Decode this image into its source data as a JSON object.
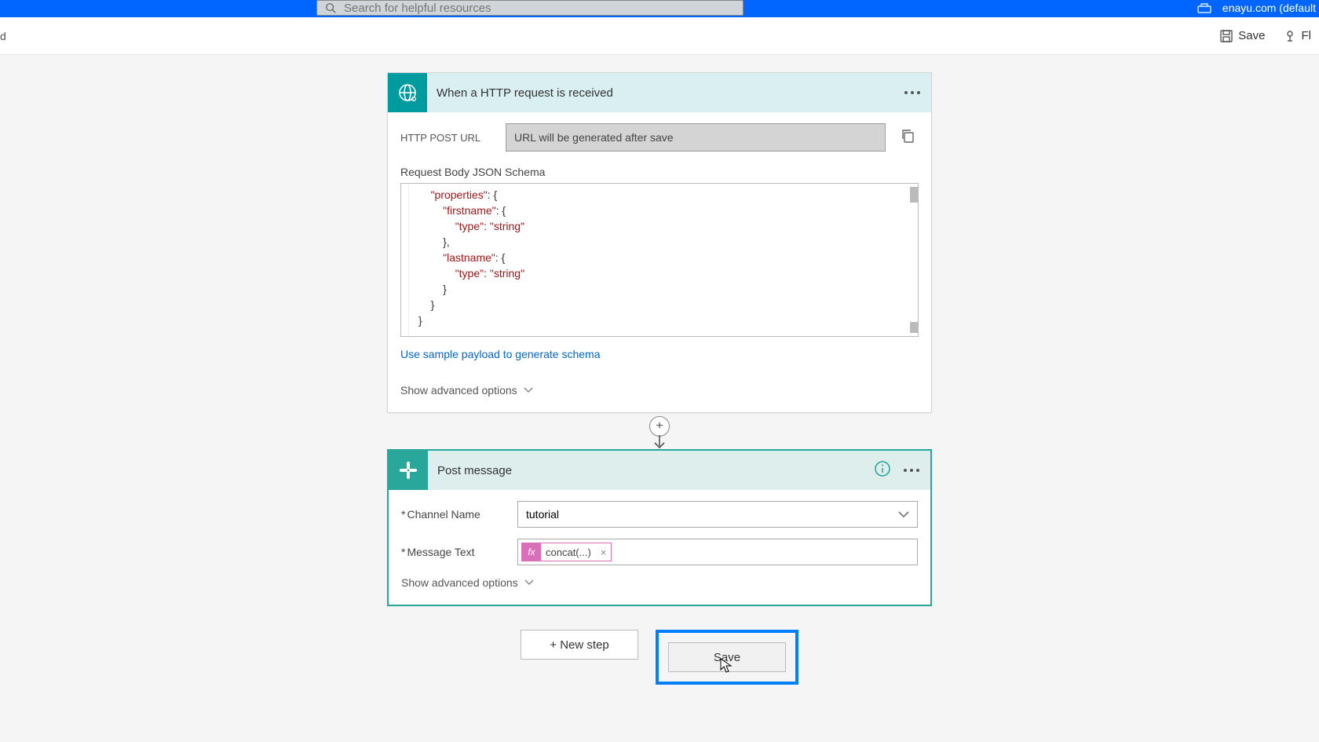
{
  "topbar": {
    "search_placeholder": "Search for helpful resources",
    "tenant": "enayu.com (default"
  },
  "cmdbar": {
    "crumb": "d",
    "save": "Save",
    "flow": "Fl"
  },
  "http": {
    "title": "When a HTTP request is received",
    "post_label": "HTTP POST URL",
    "post_value": "URL will be generated after save",
    "schema_label": "Request Body JSON Schema",
    "sample_link": "Use sample payload to generate schema",
    "advanced": "Show advanced options",
    "code": {
      "l1a": "\"properties\"",
      "l1b": ": {",
      "l2a": "\"firstname\"",
      "l2b": ": {",
      "l3a": "\"type\"",
      "l3b": ": ",
      "l3c": "\"string\"",
      "l4": "},",
      "l5a": "\"lastname\"",
      "l5b": ": {",
      "l6a": "\"type\"",
      "l6b": ": ",
      "l6c": "\"string\"",
      "l7": "}",
      "l8": "}",
      "l9": "}"
    }
  },
  "post": {
    "title": "Post message",
    "channel_label": "Channel Name",
    "channel_value": "tutorial",
    "msg_label": "Message Text",
    "token_fx": "fx",
    "token_text": "concat(...)",
    "advanced": "Show advanced options"
  },
  "bottom": {
    "newstep": "+ New step",
    "save": "Save"
  }
}
